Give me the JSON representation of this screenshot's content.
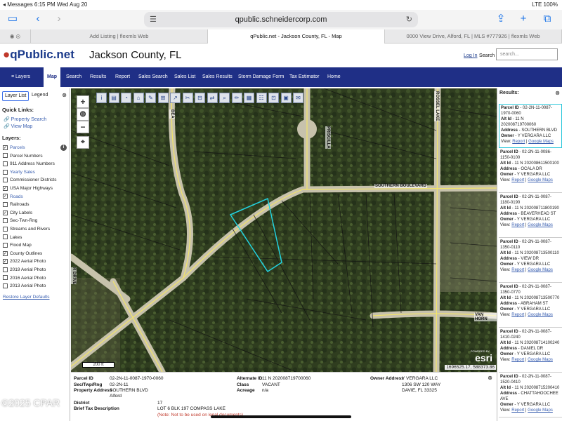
{
  "status": {
    "left": "◂ Messages  6:15 PM  Wed Aug 20",
    "right": "LTE 100%"
  },
  "browser": {
    "url": "qpublic.schneidercorp.com",
    "tabs": [
      "Add Listing | flexmls Web",
      "qPublic.net - Jackson County, FL - Map",
      "0000 View Drive, Alford, FL | MLS #777926 | flexmls Web"
    ]
  },
  "header": {
    "logo": "qPublic.net",
    "county": "Jackson County, FL",
    "login": "Log In",
    "search_label": "Search",
    "search_placeholder": "search..."
  },
  "nav": [
    "Layers",
    "Map",
    "Search",
    "Results",
    "Report",
    "Sales Search",
    "Sales List",
    "Sales Results",
    "Storm Damage Form",
    "Tax Estimator",
    "Home"
  ],
  "left": {
    "tab1": "Layer List",
    "tab2": "Legend",
    "quick_links_title": "Quick Links:",
    "quick_links": [
      "Property Search",
      "View Map"
    ],
    "layers_title": "Layers:",
    "layers": [
      {
        "label": "Parcels",
        "checked": true,
        "blue": true
      },
      {
        "label": "Parcel Numbers",
        "checked": false,
        "blue": false
      },
      {
        "label": "911 Address Numbers",
        "checked": false,
        "blue": false
      },
      {
        "label": "Yearly Sales",
        "checked": false,
        "blue": true
      },
      {
        "label": "Commissioner Districts",
        "checked": false,
        "blue": false
      },
      {
        "label": "USA Major Highways",
        "checked": true,
        "blue": false
      },
      {
        "label": "Roads",
        "checked": true,
        "blue": true
      },
      {
        "label": "Railroads",
        "checked": false,
        "blue": false
      },
      {
        "label": "City Labels",
        "checked": true,
        "blue": false
      },
      {
        "label": "Sec-Twn-Rng",
        "checked": false,
        "blue": false
      },
      {
        "label": "Streams and Rivers",
        "checked": false,
        "blue": false
      },
      {
        "label": "Lakes",
        "checked": false,
        "blue": false
      },
      {
        "label": "Flood Map",
        "checked": false,
        "blue": false
      },
      {
        "label": "County Outlines",
        "checked": true,
        "blue": false
      },
      {
        "label": "2022 Aerial Photo",
        "checked": true,
        "blue": false
      },
      {
        "label": "2019 Aerial Photo",
        "checked": false,
        "blue": false
      },
      {
        "label": "2016 Aerial Photo",
        "checked": false,
        "blue": false
      },
      {
        "label": "2013 Aerial Photo",
        "checked": false,
        "blue": false
      }
    ],
    "restore": "Restore Layer Defaults"
  },
  "map": {
    "scale": "200 ft",
    "coords": "1696525.17, 588373.86",
    "powered_by": "POWERED BY",
    "esri": "esri",
    "streets": [
      "SOUTHERN BOULEVARD",
      "PRISCILLA",
      "ROSSEL LAKE",
      "VAN HORN",
      "BEA",
      "R DRIVE"
    ]
  },
  "details": {
    "parcel_id_l": "Parcel ID",
    "parcel_id": "02-2N-11-0087-1970-0060",
    "sec_l": "Sec/Twp/Rng",
    "sec": "02-2N-11",
    "addr_l": "Property Address",
    "addr1": "SOUTHERN BLVD",
    "addr2": "Alford",
    "district_l": "District",
    "district": "17",
    "legal_l": "Brief Tax Description",
    "legal": "LOT 6 BLK 197 COMPASS LAKE",
    "warning": "(Note: Not to be used on legal documents)",
    "alt_l": "Alternate ID",
    "alt": "11 N 202008719700060",
    "class_l": "Class",
    "class": "VACANT",
    "acreage_l": "Acreage",
    "acreage": "n/a",
    "owner_l": "Owner Address",
    "owner1": "Y VERGARA LLC",
    "owner2": "1306 SW 120 WAY",
    "owner3": "DAVIE, FL 33325"
  },
  "results": {
    "title": "Results:",
    "cards": [
      {
        "pid": "02-2N-11-0087-1970-0060",
        "alt": "11 N 202008719700060",
        "addr": "SOUTHERN BLVD",
        "owner": "Y VERGARA LLC"
      },
      {
        "pid": "02-2N-11-0086-1150-0100",
        "alt": "11 N 202008611500100",
        "addr": "OCALA DR",
        "owner": "Y VERGARA LLC"
      },
      {
        "pid": "02-2N-11-0087-1180-0190",
        "alt": "11 N 202008711800190",
        "addr": "BEAVERHEAD ST",
        "owner": "Y VERGARA LLC"
      },
      {
        "pid": "02-2N-11-0087-1350-0110",
        "alt": "11 N 202008713500110",
        "addr": "VIEW DR",
        "owner": "Y VERGARA LLC"
      },
      {
        "pid": "02-2N-11-0087-1350-0770",
        "alt": "11 N 202008713500770",
        "addr": "ABRAHAM ST",
        "owner": "Y VERGARA LLC"
      },
      {
        "pid": "02-2N-11-0087-1410-0240",
        "alt": "11 N 202008714100240",
        "addr": "DANIEL DR",
        "owner": "Y VERGARA LLC"
      },
      {
        "pid": "02-2N-11-0087-1520-0410",
        "alt": "11 N 202008715200410",
        "addr": "CHATTAHOOCHEE AVE",
        "owner": "Y VERGARA LLC"
      }
    ],
    "labels": {
      "pid": "Parcel ID",
      "alt": "Alt Id",
      "addr": "Address",
      "owner": "Owner",
      "view": "View:",
      "report": "Report",
      "gmaps": "Google Maps"
    }
  },
  "watermark": "©2025 CPAR"
}
